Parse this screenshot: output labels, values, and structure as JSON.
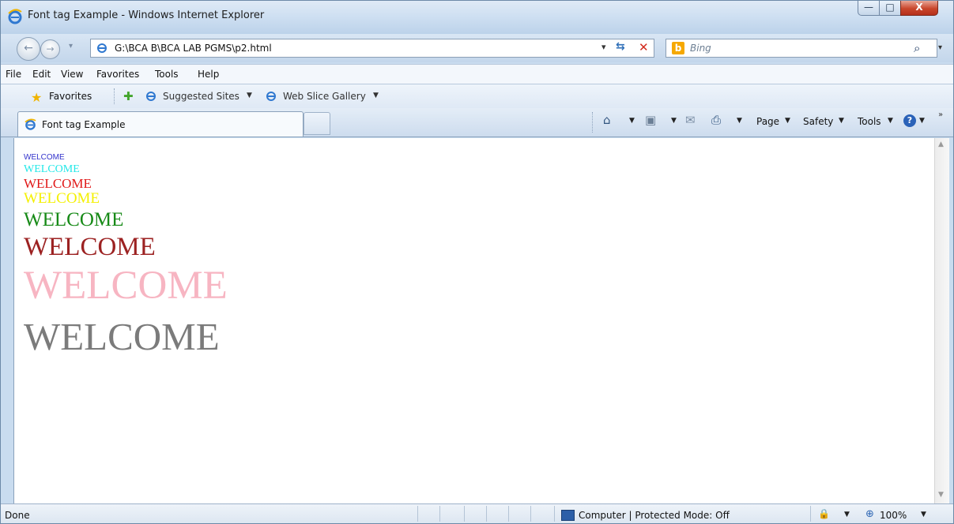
{
  "window": {
    "title": "Font tag Example - Windows Internet Explorer",
    "controls": {
      "minimize": "—",
      "maximize": "□",
      "close": "X"
    }
  },
  "nav": {
    "back_glyph": "←",
    "forward_glyph": "→",
    "dropdown_glyph": "▾",
    "address": "G:\\BCA B\\BCA LAB PGMS\\p2.html",
    "search_placeholder": "Bing",
    "bing_glyph": "b"
  },
  "menu": [
    "File",
    "Edit",
    "View",
    "Favorites",
    "Tools",
    "Help"
  ],
  "favorites_bar": {
    "label": "Favorites",
    "links": [
      "Suggested Sites",
      "Web Slice Gallery"
    ]
  },
  "tab": {
    "label": "Font tag Example"
  },
  "command_bar": {
    "page": "Page",
    "safety": "Safety",
    "tools": "Tools"
  },
  "content": {
    "lines": [
      {
        "text": "WELCOME",
        "color": "#3333cc"
      },
      {
        "text": "WELCOME",
        "color": "#22e8e8"
      },
      {
        "text": "WELCOME",
        "color": "#e01818"
      },
      {
        "text": "WELCOME",
        "color": "#f4f000"
      },
      {
        "text": "WELCOME",
        "color": "#178a17"
      },
      {
        "text": "WELCOME",
        "color": "#9c2222"
      },
      {
        "text": "WELCOME",
        "color": "#f7b5c2"
      },
      {
        "text": "WELCOME",
        "color": "#7b7b7b"
      }
    ]
  },
  "status": {
    "text": "Done",
    "zone": "Computer | Protected Mode: Off",
    "zoom": "100%"
  }
}
